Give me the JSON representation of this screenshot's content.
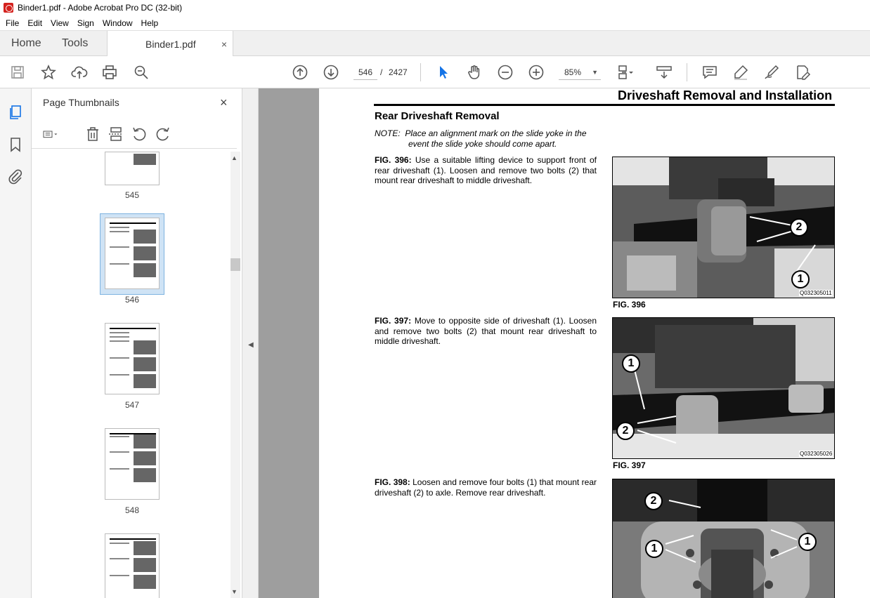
{
  "window": {
    "title": "Binder1.pdf - Adobe Acrobat Pro DC (32-bit)"
  },
  "menu": [
    "File",
    "Edit",
    "View",
    "Sign",
    "Window",
    "Help"
  ],
  "tabs": {
    "home": "Home",
    "tools": "Tools",
    "document": "Binder1.pdf",
    "close_glyph": "×"
  },
  "toolbar": {
    "current_page": "546",
    "page_separator": "/",
    "total_pages": "2427",
    "zoom": "85%",
    "zoom_caret": "▼"
  },
  "sidebar": {
    "panel_title": "Page Thumbnails",
    "close_glyph": "×",
    "thumbnails": [
      {
        "label": "545"
      },
      {
        "label": "546",
        "selected": true
      },
      {
        "label": "547"
      },
      {
        "label": "548"
      },
      {
        "label": ""
      }
    ]
  },
  "document": {
    "header": "Driveshaft Removal and Installation",
    "section": "Rear Driveshaft Removal",
    "note_label": "NOTE:",
    "note_line1": "Place an alignment mark on the slide yoke in the",
    "note_line2": "event the slide yoke should come apart.",
    "figures": [
      {
        "id": "FIG. 396:",
        "text": "Use a suitable lifting device to support front of rear driveshaft (1). Loosen and remove two bolts (2) that mount rear driveshaft to middle driveshaft.",
        "caption": "FIG. 396",
        "code": "Q032305011",
        "callouts": [
          "2",
          "1"
        ]
      },
      {
        "id": "FIG. 397:",
        "text": "Move to opposite side of driveshaft (1). Loosen and remove two bolts (2) that mount rear driveshaft to middle driveshaft.",
        "caption": "FIG. 397",
        "code": "Q032305026",
        "callouts": [
          "1",
          "2"
        ]
      },
      {
        "id": "FIG. 398:",
        "text": "Loosen and remove four bolts (1) that mount rear driveshaft (2) to axle. Remove rear driveshaft.",
        "caption": "",
        "code": "",
        "callouts": [
          "2",
          "1",
          "1"
        ]
      }
    ]
  }
}
